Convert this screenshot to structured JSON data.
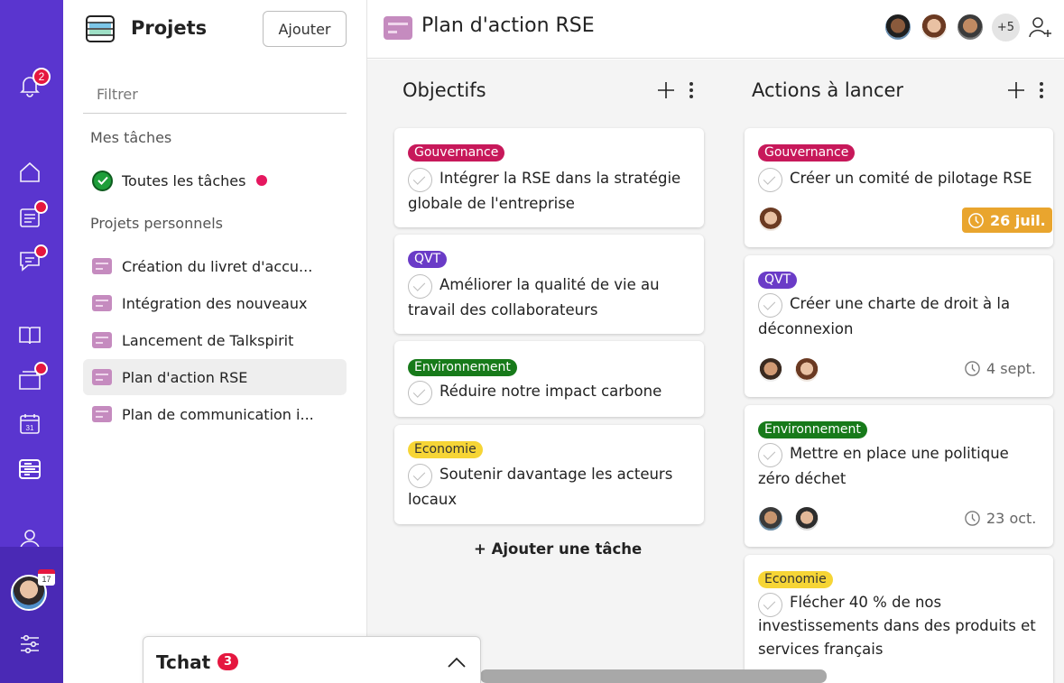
{
  "rail": {
    "notifications_count": "2",
    "icons": [
      "bell-icon",
      "home-icon",
      "feed-icon",
      "chat-icon",
      "book-icon",
      "folder-icon",
      "calendar-icon",
      "projects-icon",
      "people-icon",
      "settings-icon"
    ],
    "calendar_day": "31",
    "avatar_calendar_day": "17",
    "accent_color": "#5a35cf"
  },
  "sidebar": {
    "title": "Projets",
    "add_button": "Ajouter",
    "filter_placeholder": "Filtrer",
    "section_my_tasks": "Mes tâches",
    "all_tasks": "Toutes les tâches",
    "section_personal": "Projets personnels",
    "projects": [
      {
        "label": "Création du livret d'accu..."
      },
      {
        "label": "Intégration des nouveaux"
      },
      {
        "label": "Lancement de Talkspirit"
      },
      {
        "label": "Plan d'action RSE"
      },
      {
        "label": "Plan de communication i..."
      }
    ]
  },
  "header": {
    "project_title": "Plan d'action RSE",
    "more_members": "+5"
  },
  "columns": [
    {
      "title": "Objectifs",
      "add_task": "+ Ajouter une tâche",
      "cards": [
        {
          "tag": "Gouvernance",
          "text": "Intégrer la RSE dans la stratégie globale de l'entreprise"
        },
        {
          "tag": "QVT",
          "text": "Améliorer la qualité de vie au travail des collaborateurs"
        },
        {
          "tag": "Environnement",
          "text": "Réduire notre impact carbone"
        },
        {
          "tag": "Economie",
          "text": "Soutenir davantage les acteurs locaux"
        }
      ]
    },
    {
      "title": "Actions à lancer",
      "cards": [
        {
          "tag": "Gouvernance",
          "text": "Créer un comité de pilotage RSE",
          "due": "26 juil.",
          "overdue": true
        },
        {
          "tag": "QVT",
          "text": "Créer une charte de droit à la déconnexion",
          "due": "4 sept."
        },
        {
          "tag": "Environnement",
          "text": "Mettre en place une politique zéro déchet",
          "due": "23 oct."
        },
        {
          "tag": "Economie",
          "text": "Flécher 40 % de nos investissements dans des produits et services français"
        }
      ]
    }
  ],
  "tag_colors": {
    "Gouvernance": "#c7185a",
    "QVT": "#6a3bc7",
    "Environnement": "#177a1a",
    "Economie": "#f6d536"
  },
  "chat": {
    "title": "Tchat",
    "unread": "3"
  }
}
